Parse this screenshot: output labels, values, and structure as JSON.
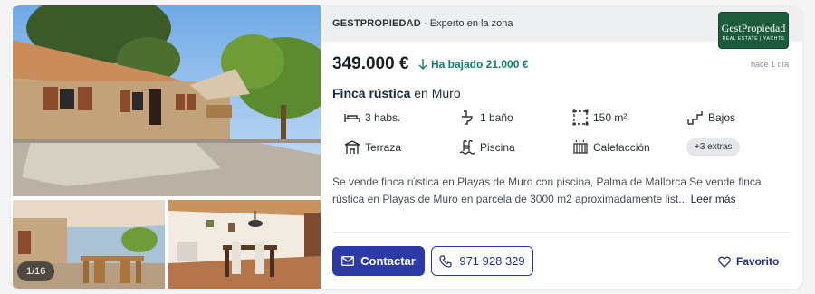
{
  "gallery": {
    "counter": "1/16",
    "photos": [
      "main-photo",
      "terrace-photo",
      "living-room-photo"
    ]
  },
  "header": {
    "agency": "GESTPROPIEDAD",
    "separator": "·",
    "tagline": "Experto en la zona",
    "logo": {
      "name": "GestPropiedad",
      "sub": "REAL ESTATE | YACHTS"
    }
  },
  "listing": {
    "price": "349.000 €",
    "price_drop": "Ha bajado 21.000 €",
    "posted": "hace 1 día",
    "type": "Finca rústica",
    "location": "en Muro",
    "features": [
      {
        "icon": "bed-icon",
        "label": "3 habs."
      },
      {
        "icon": "toilet-icon",
        "label": "1 baño"
      },
      {
        "icon": "area-icon",
        "label": "150 m²"
      },
      {
        "icon": "stairs-icon",
        "label": "Bajos"
      },
      {
        "icon": "terrace-icon",
        "label": "Terraza"
      },
      {
        "icon": "pool-icon",
        "label": "Piscina"
      },
      {
        "icon": "heating-icon",
        "label": "Calefacción"
      }
    ],
    "extras": "+3 extras",
    "description": "Se vende finca rústica en Playas de Muro con piscina, Palma de Mallorca  Se vende finca rústica en Playas de Muro en parcela de 3000 m2 aproximadamente list...",
    "read_more": "Leer más"
  },
  "actions": {
    "contact": "Contactar",
    "phone": "971 928 329",
    "favorite": "Favorito"
  },
  "colors": {
    "primary": "#2c3aa8",
    "price_drop": "#128067",
    "logo_bg": "#1c5c3c",
    "header_bg": "#eeeff1"
  }
}
